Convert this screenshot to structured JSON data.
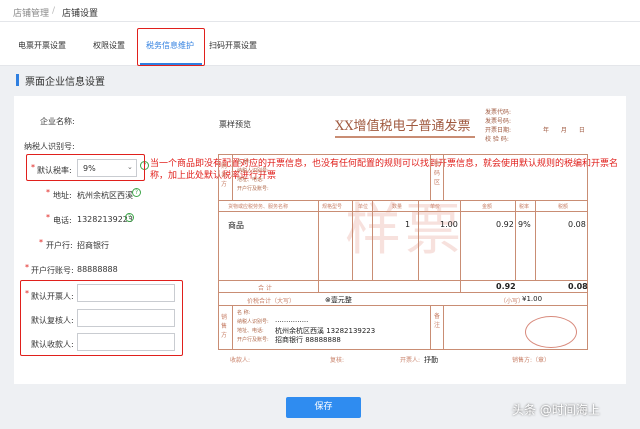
{
  "breadcrumb": {
    "parent": "店铺管理",
    "sep": "/",
    "current": "店铺设置"
  },
  "tabs": [
    {
      "label": "电票开票设置",
      "active": false
    },
    {
      "label": "权限设置",
      "active": false
    },
    {
      "label": "税务信息维护",
      "active": true
    },
    {
      "label": "扫码开票设置",
      "active": false
    }
  ],
  "section_title": "票面企业信息设置",
  "form": {
    "company_name_label": "企业名称:",
    "taxpayer_id_label": "纳税人识别号:",
    "tax_rate_label": "默认税率:",
    "tax_rate_value": "9%",
    "address_label": "地址:",
    "address_value": "杭州余杭区西溪",
    "phone_label": "电话:",
    "phone_value": "13282139223",
    "bank_label": "开户行:",
    "bank_value": "招商银行",
    "account_label": "开户行账号:",
    "account_value": "88888888",
    "drawer_label": "默认开票人:",
    "reviewer_label": "默认复核人:",
    "payee_label": "默认收款人:"
  },
  "annotation": "当一个商品即没有配置对应的开票信息，也没有任何配置的规则可以找到开票信息，就会使用默认规则的税编和开票名称，加上此处默认税率进行开票",
  "invoice": {
    "preview_label": "票样预览",
    "title": "XX增值税电子普通发票",
    "watermark": "样票",
    "meta_labels": [
      "发票代码:",
      "发票号码:",
      "开票日期:",
      "校 验 码:"
    ],
    "date_units": [
      "年",
      "月",
      "日"
    ],
    "buyer_section": "购买方",
    "password_section": "密码区",
    "buyer_labels": [
      "名      称:",
      "纳税人识别号:",
      "地址、电话:",
      "开户行及账号:"
    ],
    "columns": [
      "货物或应税劳务、服务名称",
      "规格型号",
      "单位",
      "数量",
      "单价",
      "金额",
      "税率",
      "税额"
    ],
    "item": {
      "name": "商品",
      "qty": "1",
      "price": "1.00",
      "amount": "0.92",
      "rate": "9%",
      "tax": "0.08"
    },
    "total_label": "合        计",
    "total_amount": "0.92",
    "total_tax": "0.08",
    "grand_label": "价税合计（大写）",
    "grand_words": "⊗壹元整",
    "grand_small_label": "（小写）",
    "grand_small": "¥1.00",
    "seller_section": "销售方",
    "remark_section": "备注",
    "seller_labels": [
      "名      称:",
      "纳税人识别号:",
      "地址、电话:",
      "开户行及账号:"
    ],
    "seller_id": "···············",
    "seller_addr": "杭州余杭区西溪 13282139223",
    "seller_bank": "招商银行 88888888",
    "footer": {
      "payee": "收款人:",
      "reviewer": "复核:",
      "drawer": "开票人:",
      "drawer_value": "抒勤",
      "seller": "销售方:（章）"
    }
  },
  "save_button": "保存",
  "watermark_credit": "头条 @时间海上"
}
